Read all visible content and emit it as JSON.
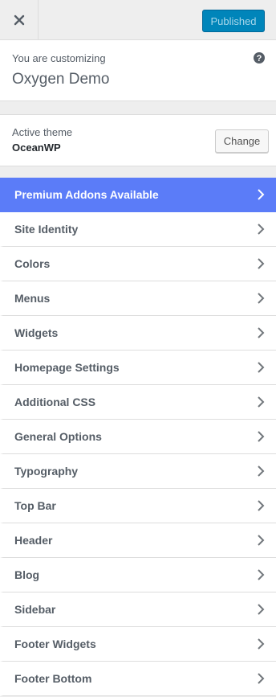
{
  "header": {
    "close_icon": "close-icon",
    "publish_label": "Published"
  },
  "info": {
    "subtitle": "You are customizing",
    "site_name": "Oxygen Demo",
    "help_icon": "help-icon"
  },
  "theme": {
    "label": "Active theme",
    "name": "OceanWP",
    "change_label": "Change"
  },
  "menu": {
    "items": [
      {
        "label": "Premium Addons Available",
        "highlight": true
      },
      {
        "label": "Site Identity"
      },
      {
        "label": "Colors"
      },
      {
        "label": "Menus"
      },
      {
        "label": "Widgets"
      },
      {
        "label": "Homepage Settings"
      },
      {
        "label": "Additional CSS"
      },
      {
        "label": "General Options"
      },
      {
        "label": "Typography"
      },
      {
        "label": "Top Bar"
      },
      {
        "label": "Header"
      },
      {
        "label": "Blog"
      },
      {
        "label": "Sidebar"
      },
      {
        "label": "Footer Widgets"
      },
      {
        "label": "Footer Bottom"
      }
    ]
  },
  "colors": {
    "publish_button": "#0085ba",
    "premium_highlight": "#5b7cf8",
    "background": "#eeeeee"
  }
}
